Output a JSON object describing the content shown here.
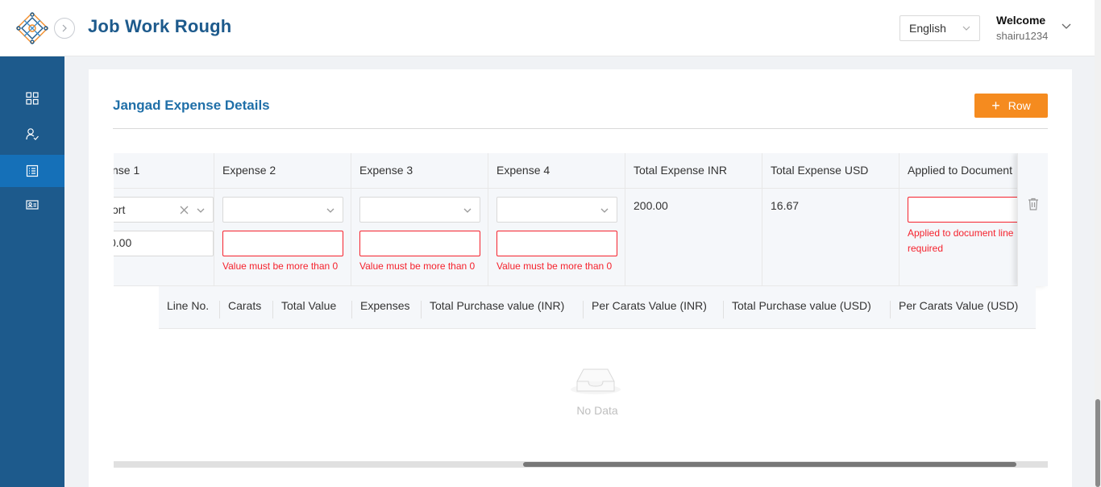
{
  "header": {
    "app_title": "Job Work Rough",
    "language": "English",
    "welcome": "Welcome",
    "username": "shairu1234"
  },
  "sidebar": {
    "items": [
      {
        "icon": "dashboard-grid-icon",
        "active": false
      },
      {
        "icon": "users-icon",
        "active": false
      },
      {
        "icon": "list-document-icon",
        "active": true
      },
      {
        "icon": "id-card-icon",
        "active": false
      }
    ]
  },
  "section": {
    "title": "Jangad Expense Details",
    "add_row_label": "Row"
  },
  "expense_table": {
    "columns": [
      "nse 1",
      "Expense 2",
      "Expense 3",
      "Expense 4",
      "Total Expense INR",
      "Total Expense USD",
      "Applied to Document"
    ],
    "row": {
      "expense1_select": "ort",
      "expense1_value": "0.00",
      "error_value": "Value must be more than 0",
      "total_expense_inr": "200.00",
      "total_expense_usd": "16.67",
      "applied_error_line1": "Applied to document line",
      "applied_error_line2": "required"
    }
  },
  "nested_table": {
    "columns": [
      "Line No.",
      "Carats",
      "Total Value",
      "Expenses",
      "Total Purchase value (INR)",
      "Per Carats Value (INR)",
      "Total Purchase value (USD)",
      "Per Carats Value (USD)"
    ],
    "empty_text": "No Data"
  },
  "colors": {
    "primary": "#1d5a8c",
    "sidebar_active": "#1570b8",
    "accent_button": "#f58b1f",
    "error": "#f5222d"
  }
}
